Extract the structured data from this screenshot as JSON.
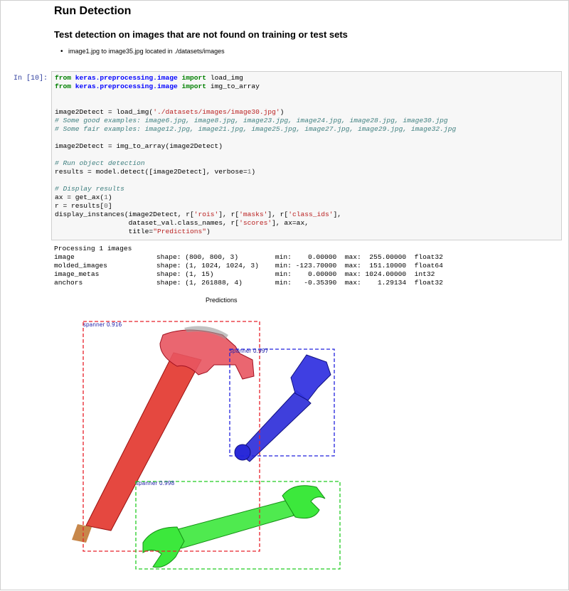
{
  "markdown": {
    "title": "Run Detection",
    "subtitle": "Test detection on images that are not found on training or test sets",
    "bullet": "image1.jpg to image35.jpg located in ./datasets/images"
  },
  "cell": {
    "prompt": "In [10]:",
    "code": {
      "l1": {
        "kw1": "from",
        "mod": "keras.preprocessing.image",
        "kw2": "import",
        "name": "load_img"
      },
      "l2": {
        "kw1": "from",
        "mod": "keras.preprocessing.image",
        "kw2": "import",
        "name": "img_to_array"
      },
      "l5": {
        "pre": "image2Detect = load_img(",
        "str": "'./datasets/images/image30.jpg'",
        "post": ")"
      },
      "l6": "# Some good examples: image6.jpg, image8.jpg, image23.jpg, image24.jpg, image28.jpg, image30.jpg",
      "l7": "# Some fair examples: image12.jpg, image21.jpg, image25.jpg, image27.jpg, image29.jpg, image32.jpg",
      "l9": "image2Detect = img_to_array(image2Detect)",
      "l11": "# Run object detection",
      "l12": {
        "pre": "results = model.detect([image2Detect], verbose=",
        "num": "1",
        "post": ")"
      },
      "l14": "# Display results",
      "l15": {
        "pre": "ax = get_ax(",
        "num": "1",
        "post": ")"
      },
      "l16": {
        "pre": "r = results[",
        "num": "0",
        "post": "]"
      },
      "l17": {
        "a": "display_instances(image2Detect, r[",
        "s1": "'rois'",
        "b": "], r[",
        "s2": "'masks'",
        "c": "], r[",
        "s3": "'class_ids'",
        "d": "],"
      },
      "l18": {
        "a": "                  dataset_val.class_names, r[",
        "s1": "'scores'",
        "b": "], ax=ax,"
      },
      "l19": {
        "a": "                  title=",
        "s1": "\"Predictions\"",
        "b": ")"
      }
    }
  },
  "output": {
    "text": "Processing 1 images\nimage                    shape: (800, 800, 3)         min:    0.00000  max:  255.00000  float32\nmolded_images            shape: (1, 1024, 1024, 3)    min: -123.70000  max:  151.10000  float64\nimage_metas              shape: (1, 15)               min:    0.00000  max: 1024.00000  int32\nanchors                  shape: (1, 261888, 4)        min:   -0.35390  max:    1.29134  float32"
  },
  "plot": {
    "title": "Predictions",
    "detections": [
      {
        "label": "spanner 0.916",
        "color": "#e8212a"
      },
      {
        "label": "spanner 0.997",
        "color": "#2222dd"
      },
      {
        "label": "spanner 0.998",
        "color": "#22cc22"
      }
    ],
    "colors": {
      "hammer_fill": "#e0281e",
      "hammer_head": "#e85560",
      "wrench_blue": "#2a2ad8",
      "wrench_green": "#3ce83c",
      "handle_tip": "#c7874a"
    }
  }
}
